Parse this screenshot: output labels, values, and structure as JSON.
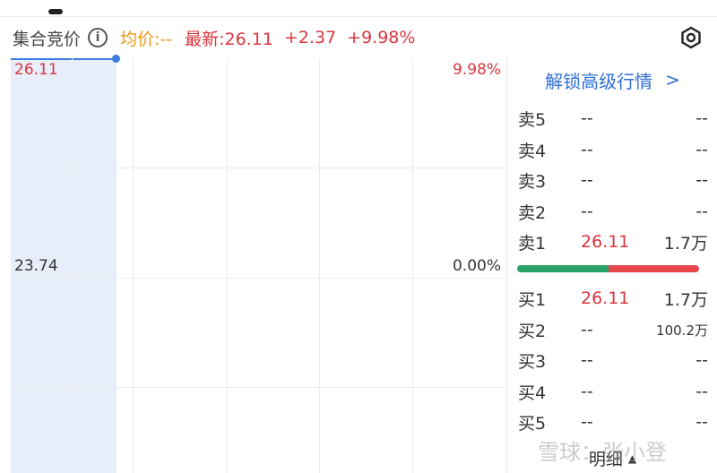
{
  "header": {
    "title": "集合竞价",
    "avg": "均价:--",
    "latest": "最新:26.11",
    "change": "+2.37",
    "change_pct": "+9.98%"
  },
  "chart": {
    "price_high": "26.11",
    "price_mid": "23.74",
    "pct_high": "9.98%",
    "pct_mid": "0.00%"
  },
  "panel": {
    "unlock": "解锁高级行情",
    "unlock_chevron": ">",
    "sell": [
      {
        "label": "卖5",
        "price": "--",
        "vol": "--"
      },
      {
        "label": "卖4",
        "price": "--",
        "vol": "--"
      },
      {
        "label": "卖3",
        "price": "--",
        "vol": "--"
      },
      {
        "label": "卖2",
        "price": "--",
        "vol": "--"
      },
      {
        "label": "卖1",
        "price": "26.11",
        "vol": "1.7万"
      }
    ],
    "buy": [
      {
        "label": "买1",
        "price": "26.11",
        "vol": "1.7万"
      },
      {
        "label": "买2",
        "price": "--",
        "vol": "100.2万"
      },
      {
        "label": "买3",
        "price": "--",
        "vol": "--"
      },
      {
        "label": "买4",
        "price": "--",
        "vol": "--"
      },
      {
        "label": "买5",
        "price": "--",
        "vol": "--"
      }
    ],
    "detail": "明细",
    "detail_icon": "triangle-up-icon"
  },
  "watermark": "雪球：张小登",
  "colors": {
    "red": "#d9363e",
    "green": "#2aa36b",
    "blue": "#2f6fd6",
    "orange": "#e89a1a"
  }
}
